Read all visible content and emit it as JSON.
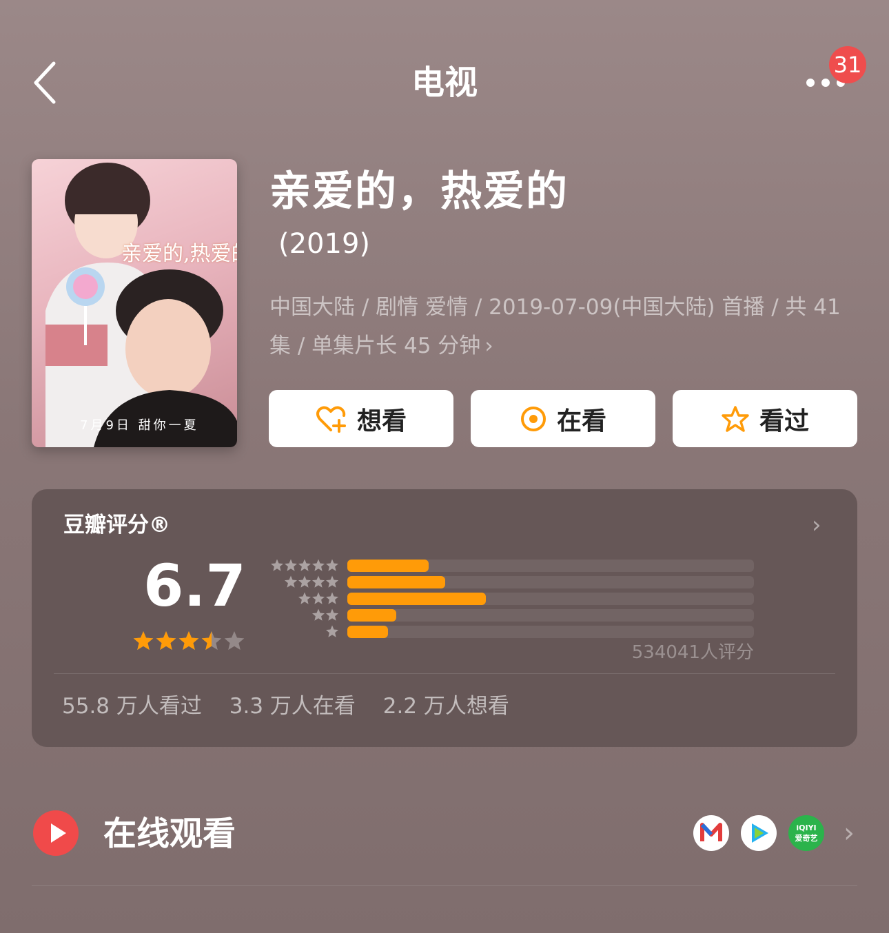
{
  "header": {
    "title": "电视",
    "notification_count": "31"
  },
  "poster": {
    "title": "亲爱的,热爱的",
    "tagline": "7月9日 甜你一夏"
  },
  "show": {
    "title": "亲爱的，热爱的",
    "year": "(2019)",
    "meta": "中国大陆 / 剧情 爱情 / 2019-07-09(中国大陆) 首播 / 共 41 集 / 单集片长 45 分钟"
  },
  "actions": {
    "want_label": "想看",
    "watching_label": "在看",
    "watched_label": "看过"
  },
  "rating": {
    "title": "豆瓣评分®",
    "score": "6.7",
    "star_rating": 3.5,
    "distribution": [
      {
        "stars": 5,
        "fraction": 0.2
      },
      {
        "stars": 4,
        "fraction": 0.24
      },
      {
        "stars": 3,
        "fraction": 0.34
      },
      {
        "stars": 2,
        "fraction": 0.12
      },
      {
        "stars": 1,
        "fraction": 0.1
      }
    ],
    "count_text": "534041人评分",
    "stats": {
      "watched": "55.8 万人看过",
      "watching": "3.3 万人在看",
      "want": "2.2 万人想看"
    }
  },
  "online": {
    "label": "在线观看",
    "platforms": [
      "mgtv-icon",
      "tencent-video-icon",
      "iqiyi-icon"
    ],
    "iqiyi_text": "iQIYI 爱奇艺"
  },
  "colors": {
    "accent": "#ff9b08",
    "play_red": "#f04a4a",
    "badge_red": "#ef4d4d"
  }
}
